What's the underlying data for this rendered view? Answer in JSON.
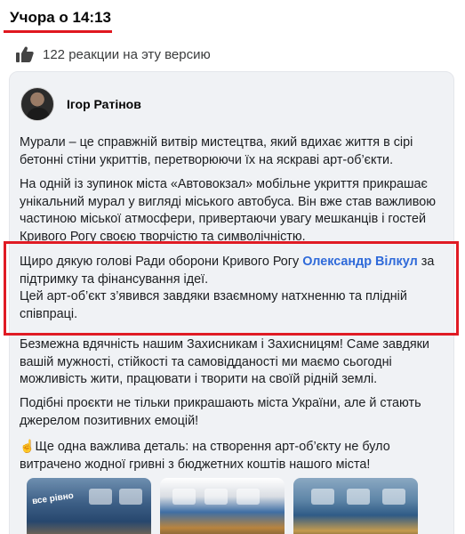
{
  "header": {
    "time_label": "Учора о 14:13"
  },
  "reactions": {
    "icon": "thumbs-up-icon",
    "text": "122 реакции на эту версию"
  },
  "post": {
    "author": "Ігор Ратінов",
    "paragraphs": {
      "p1": "Мурали – це справжній витвір мистецтва, який вдихає життя в сірі бетонні стіни укриттів, перетворюючи їх на яскраві арт-об’єкти.",
      "p2": "На одній із зупинок міста «Автовокзал» мобільне укриття прикрашає унікальний мурал у вигляді міського автобуса. Він вже став важливою частиною міської атмосфери, привертаючи увагу мешканців і гостей Кривого Рогу своєю творчістю та символічністю.",
      "p3_before": "Щиро дякую голові Ради оборони Кривого Рогу ",
      "p3_mention": "Олександр Вілкул",
      "p3_after": " за підтримку та фінансування  ідеї.",
      "p3_second": "Цей арт-об’єкт з’явився завдяки взаємному натхненню та плідній співпраці.",
      "p4": "Безмежна вдячність нашим Захисникам і Захисницям! Саме завдяки вашій мужності, стійкості та самовідданості ми маємо сьогодні можливість жити, працювати і творити на своїй рідній землі.",
      "p5": "Подібні проєкти не тільки прикрашають міста України, але й стають джерелом позитивних емоцій!",
      "p6_icon": "☝",
      "p6": "Ще одна важлива деталь: на створення арт-об’єкту не було витрачено жодної гривні з бюджетних коштів нашого міста!"
    },
    "photo_text": "все рівно"
  },
  "colors": {
    "highlight": "#e01b24",
    "mention": "#2f6ad9",
    "card_bg": "#f0f2f5"
  }
}
